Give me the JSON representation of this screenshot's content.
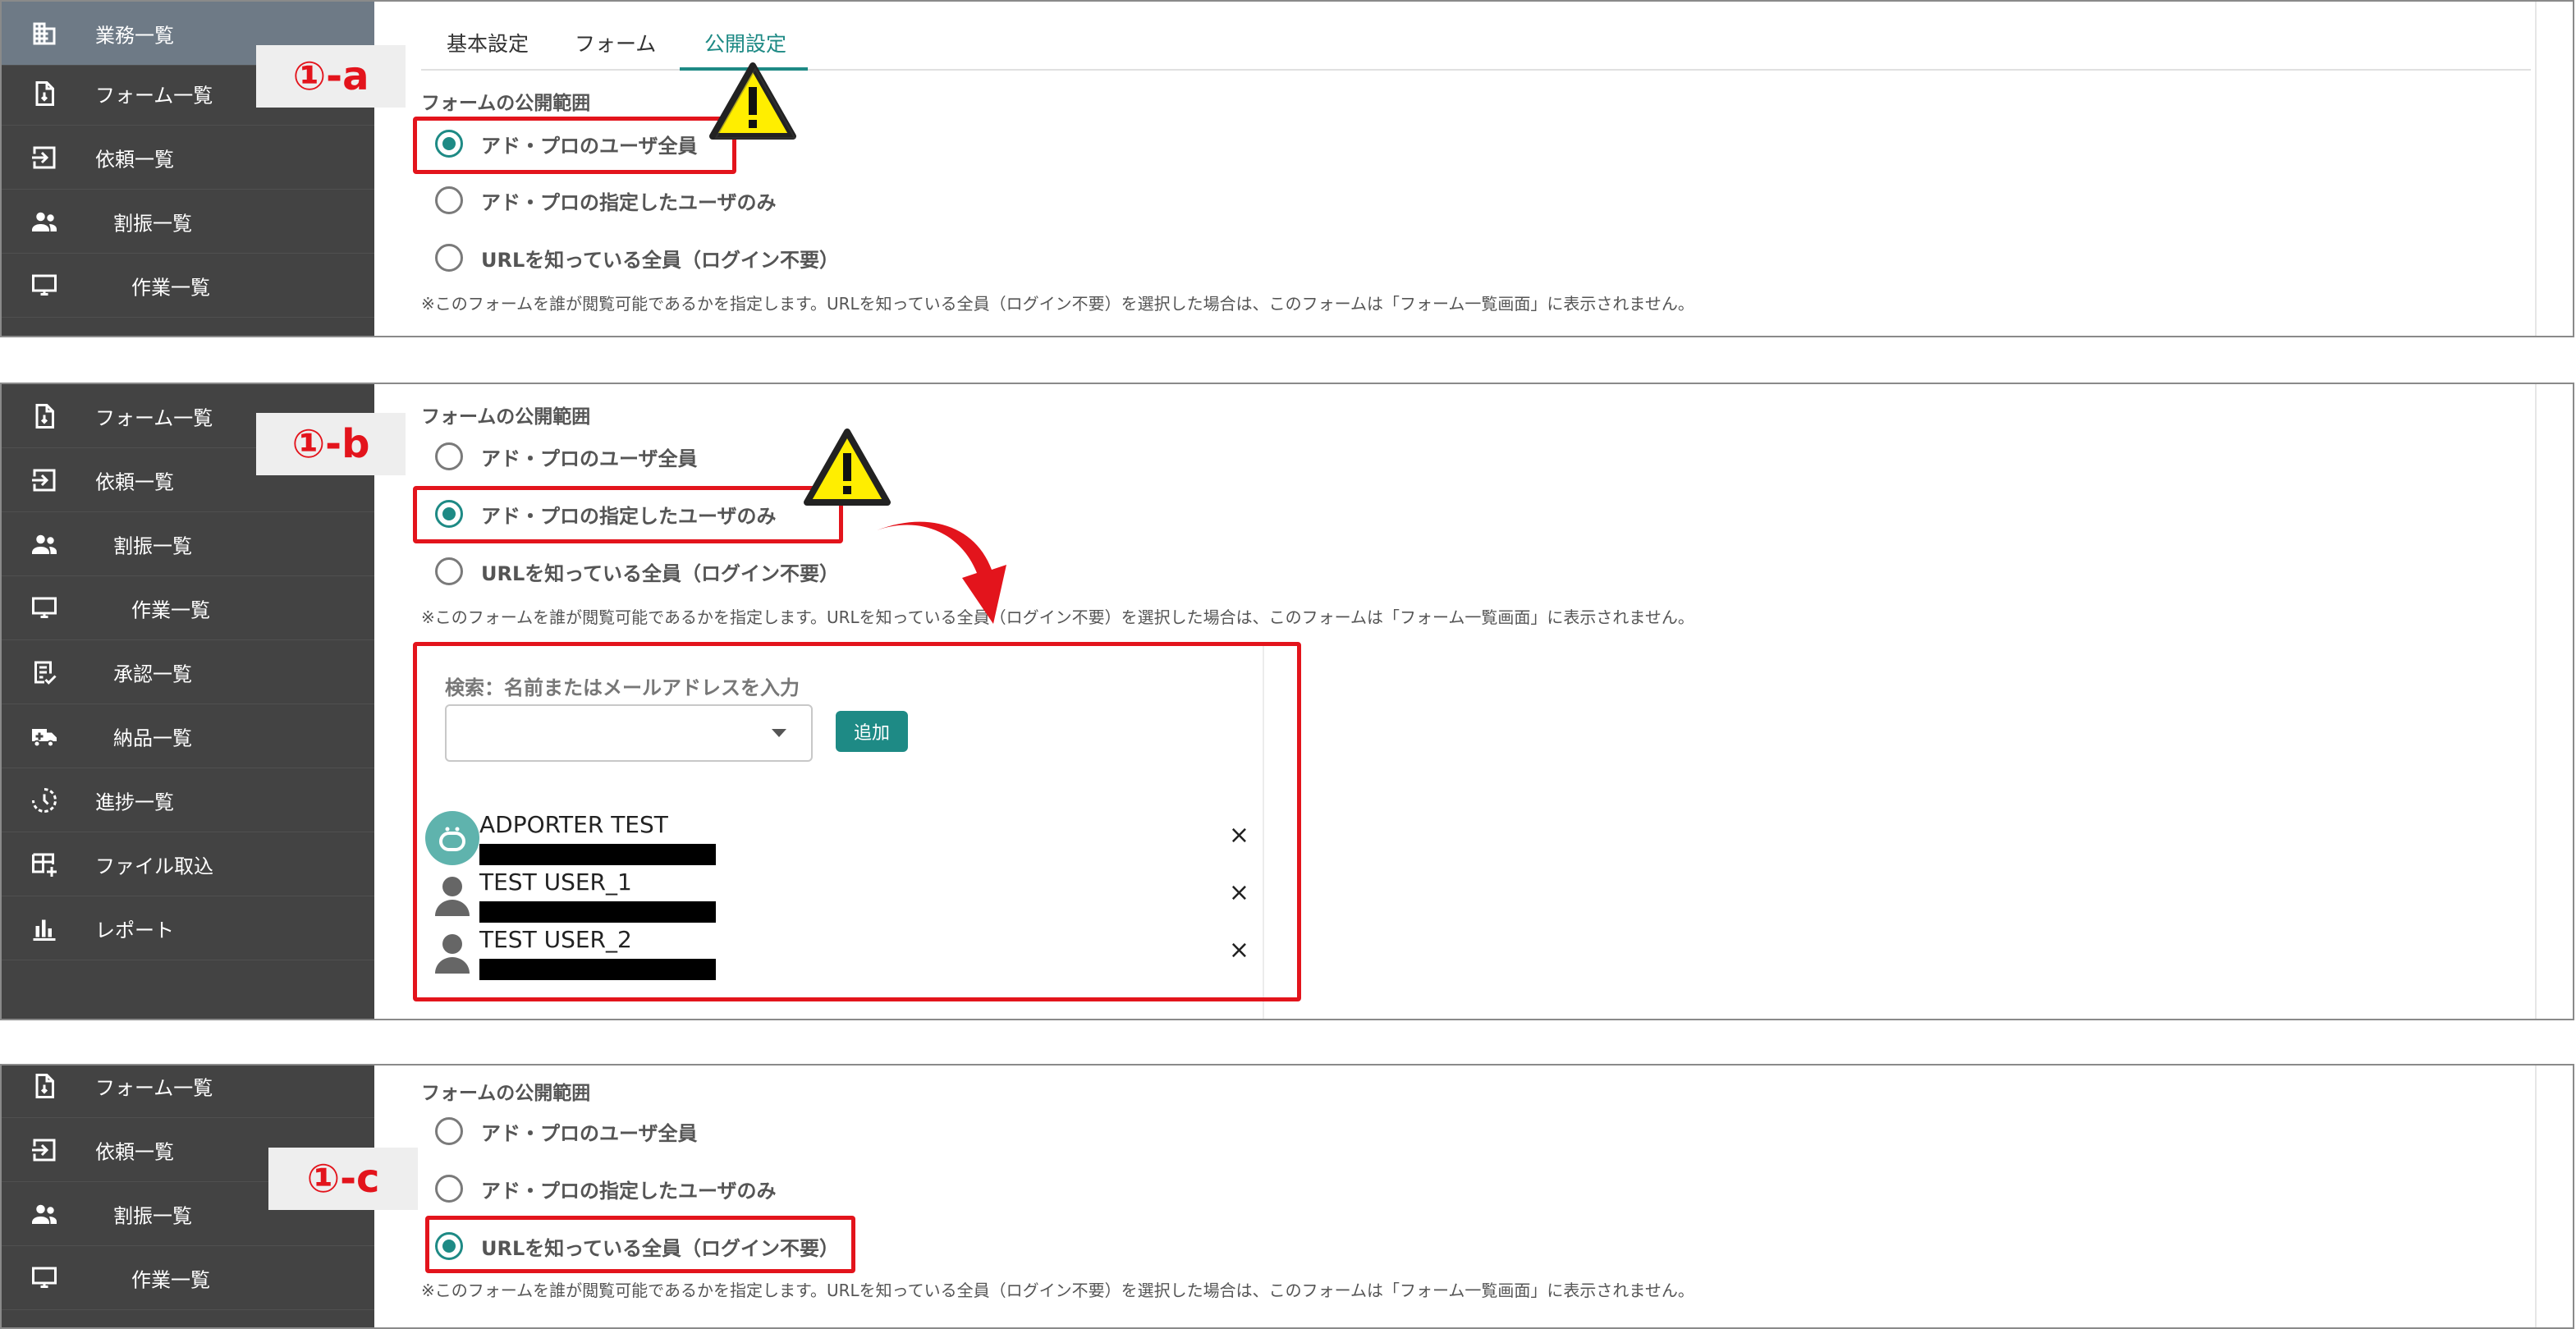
{
  "nav": {
    "business_list": "業務一覧",
    "form_list": "フォーム一覧",
    "request_list": "依頼一覧",
    "assign_list": "割振一覧",
    "work_list": "作業一覧",
    "approval_list": "承認一覧",
    "delivery_list": "納品一覧",
    "progress_list": "進捗一覧",
    "file_import": "ファイル取込",
    "report": "レポート"
  },
  "tabs": {
    "basic": "基本設定",
    "form": "フォーム",
    "publish": "公開設定"
  },
  "section_title": "フォームの公開範囲",
  "options": {
    "all_users": "アド・プロのユーザ全員",
    "specified_users": "アド・プロの指定したユーザのみ",
    "anyone_with_url": "URLを知っている全員（ログイン不要）"
  },
  "note": "※このフォームを誰が閲覧可能であるかを指定します。URLを知っている全員（ログイン不要）を選択した場合は、このフォームは「フォーム一覧画面」に表示されません。",
  "callouts": {
    "a": "①-a",
    "b": "①-b",
    "c": "①-c"
  },
  "picker": {
    "label": "検索：名前またはメールアドレスを入力",
    "add_button": "追加"
  },
  "users": [
    {
      "name": "ADPORTER TEST",
      "remove": "×"
    },
    {
      "name": "TEST USER_1",
      "remove": "×"
    },
    {
      "name": "TEST USER_2",
      "remove": "×"
    }
  ],
  "icons": {
    "business": "building-icon",
    "form": "document-icon",
    "request": "login-arrow-icon",
    "assign": "people-icon",
    "work": "monitor-icon",
    "approval": "checklist-icon",
    "delivery": "truck-icon",
    "progress": "clock-history-icon",
    "file_import": "table-add-icon",
    "report": "bar-chart-icon",
    "warning": "warning-icon",
    "arrow": "curved-arrow-icon"
  },
  "colors": {
    "accent": "#1e8a85",
    "highlight": "#e3141c",
    "sidebar": "#434343",
    "warning": "#ffee00"
  }
}
